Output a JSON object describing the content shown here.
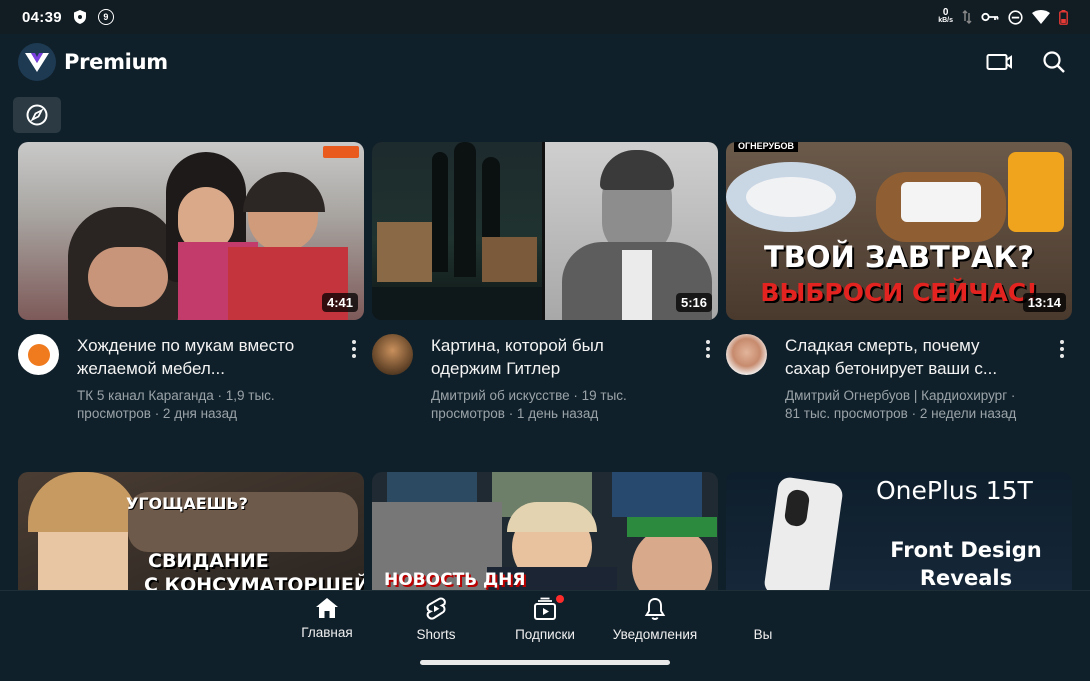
{
  "status_bar": {
    "time": "04:39",
    "notif_count": "9",
    "net_speed": "0",
    "net_unit": "kB/s"
  },
  "header": {
    "brand": "Premium"
  },
  "videos": [
    {
      "title": "Хождение по мукам вместо желаемой мебел...",
      "channel_line": "ТК 5 канал Караганда · 1,9 тыс. просмотров · 2 дня назад",
      "duration": "4:41"
    },
    {
      "title": "Картина, которой был одержим Гитлер",
      "channel_line": "Дмитрий об искусстве · 19 тыс. просмотров · 1 день назад",
      "duration": "5:16"
    },
    {
      "title": "Сладкая смерть, почему сахар бетонирует ваши с...",
      "channel_line": "Дмитрий Огнербуов | Кардиохирург · 81 тыс. просмотров · 2 недели назад",
      "duration": "13:14"
    }
  ],
  "thumb_texts": {
    "t3_line1": "ТВОЙ ЗАВТРАК?",
    "t3_line2": "ВЫБРОСИ СЕЙЧАС!",
    "t3_tag": "ОГНЕРУБОВ",
    "t4_line1": "УГОЩАЕШЬ?",
    "t4_line2": "СВИДАНИЕ",
    "t4_line3": "С КОНСУМАТОРШЕЙ",
    "t5_line": "НОВОСТЬ ДНЯ",
    "t6_brand": "OnePlus 15T",
    "t6_line1": "Front Design",
    "t6_line2": "Reveals"
  },
  "bottom_nav": [
    {
      "label": "Главная",
      "icon": "home-icon"
    },
    {
      "label": "Shorts",
      "icon": "shorts-icon"
    },
    {
      "label": "Подписки",
      "icon": "subscriptions-icon"
    },
    {
      "label": "Уведомления",
      "icon": "bell-icon"
    },
    {
      "label": "Вы",
      "icon": "profile-icon"
    }
  ]
}
